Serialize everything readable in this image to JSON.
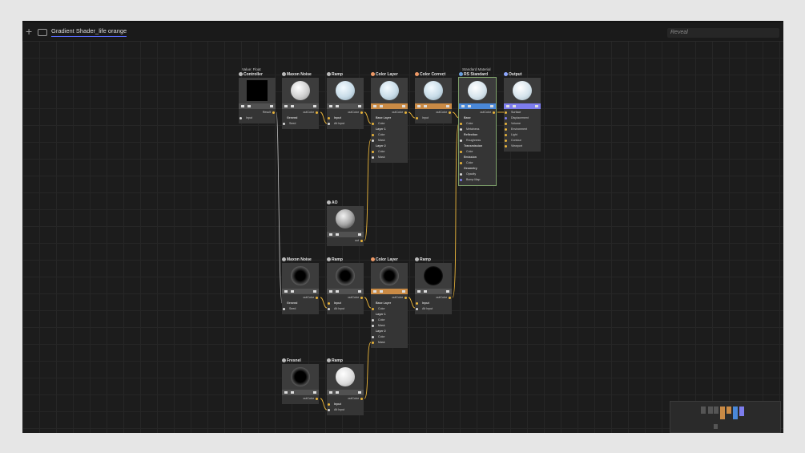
{
  "tab": {
    "title": "Gradient Shader_life orange"
  },
  "search": {
    "placeholder": "Reveal"
  },
  "nodes": {
    "controller": {
      "subtitle": "Value: Float",
      "title": "Controller",
      "in": "Input",
      "out": "Result"
    },
    "maxon1": {
      "title": "Maxon Noise",
      "out": "outColor",
      "r1": "General",
      "r2": "Seed"
    },
    "ramp1": {
      "title": "Ramp",
      "out": "outColor",
      "r1": "Input",
      "r2": "Alt Input"
    },
    "colorlayer1": {
      "title": "Color Layer",
      "out": "outColor",
      "r1": "Base Layer",
      "r2": "Color",
      "r3": "Layer 1",
      "r4": "Color",
      "r5": "Mask",
      "r6": "Layer 2",
      "r7": "Color",
      "r8": "Mask"
    },
    "colorcorrect": {
      "title": "Color Correct",
      "out": "outColor",
      "r1": "Input"
    },
    "rsstandard": {
      "subtitle": "Standard Material",
      "title": "RS Standard",
      "out": "outColor",
      "r1": "Base",
      "r2": "Color",
      "r3": "Metalness",
      "r4": "Reflection",
      "r5": "Roughness",
      "r6": "Transmission",
      "r7": "Color",
      "r8": "Emission",
      "r9": "Color",
      "r10": "Geometry",
      "r11": "Opacity",
      "r12": "Bump Map"
    },
    "output": {
      "title": "Output",
      "r1": "Surface",
      "r2": "Displacement",
      "r3": "Volume",
      "r4": "Environment",
      "r5": "Light",
      "r6": "Contour",
      "r7": "Viewport"
    },
    "ao": {
      "title": "AO",
      "out": "out"
    },
    "maxon2": {
      "title": "Maxon Noise",
      "out": "outColor",
      "r1": "General",
      "r2": "Seed"
    },
    "ramp2": {
      "title": "Ramp",
      "out": "outColor",
      "r1": "Input",
      "r2": "Alt Input"
    },
    "colorlayer2": {
      "title": "Color Layer",
      "out": "outColor",
      "r1": "Base Layer",
      "r2": "Color",
      "r3": "Layer 1",
      "r4": "Color",
      "r5": "Mask",
      "r6": "Layer 2",
      "r7": "Color",
      "r8": "Mask"
    },
    "ramp3": {
      "title": "Ramp",
      "out": "outColor",
      "r1": "Input",
      "r2": "Alt Input"
    },
    "fresnel": {
      "title": "Fresnel",
      "out": "outColor"
    },
    "ramp4": {
      "title": "Ramp",
      "out": "outColor",
      "r1": "Input",
      "r2": "Alt Input"
    }
  },
  "colors": {
    "wire": "#e9b43a",
    "accent": "#5a6cff",
    "colorlayer_bar": "#c98a45",
    "rs_bar": "#4a88d8",
    "output_bar": "#7d7ded"
  },
  "icons": [
    "plus-icon",
    "frame-icon",
    "node-type-icon"
  ]
}
